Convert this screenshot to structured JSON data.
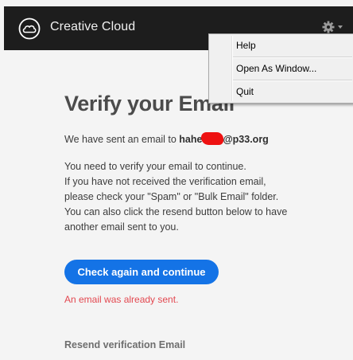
{
  "app": {
    "title": "Creative Cloud",
    "brand_color": "#1d1d1d",
    "logo_icon": "creative-cloud-logo",
    "settings_icon": "gear-icon"
  },
  "menu": {
    "items": [
      {
        "label": "Help"
      },
      {
        "label": "Open As Window..."
      },
      {
        "label": "Quit"
      }
    ]
  },
  "verify": {
    "heading": "Verify your Email",
    "sent_prefix": "We have sent an email to ",
    "email_start": "hahe",
    "email_end": "@p33.org",
    "lines": [
      "You need to verify your email to continue.",
      "If you have not received the verification email,",
      "please check your \"Spam\" or \"Bulk Email\" folder.",
      "You can also click the resend button below to have",
      "another email sent to you."
    ],
    "primary_button": "Check again and continue",
    "error": "An email was already sent.",
    "resend_link": "Resend verification Email"
  },
  "colors": {
    "accent": "#1473e6",
    "error": "#e34850"
  }
}
